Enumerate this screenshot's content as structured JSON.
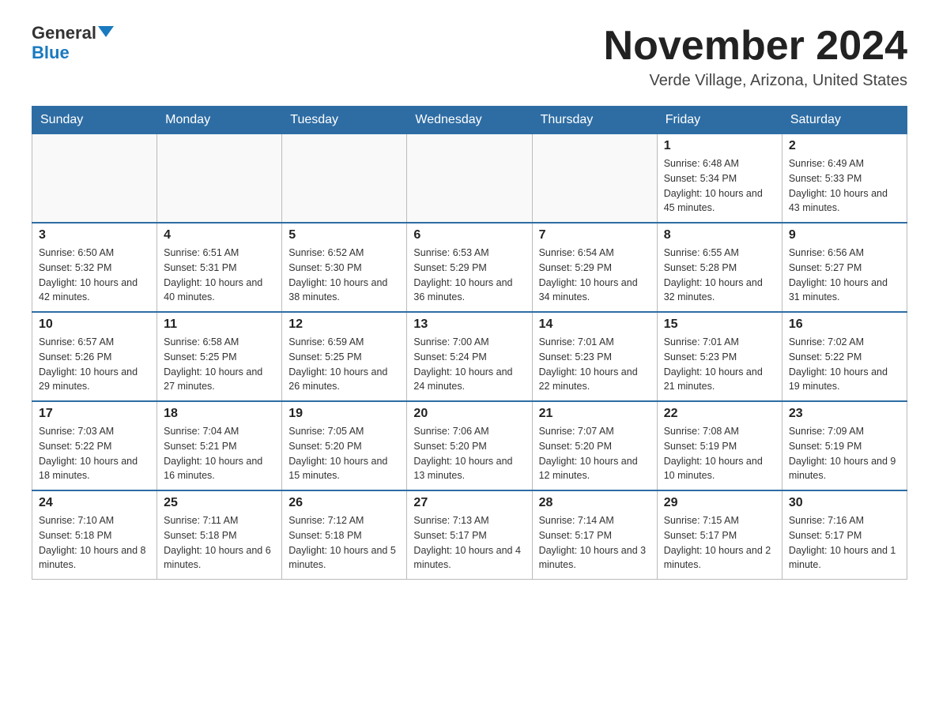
{
  "header": {
    "logo_general": "General",
    "logo_blue": "Blue",
    "month_title": "November 2024",
    "location": "Verde Village, Arizona, United States"
  },
  "weekdays": [
    "Sunday",
    "Monday",
    "Tuesday",
    "Wednesday",
    "Thursday",
    "Friday",
    "Saturday"
  ],
  "weeks": [
    [
      {
        "day": "",
        "info": ""
      },
      {
        "day": "",
        "info": ""
      },
      {
        "day": "",
        "info": ""
      },
      {
        "day": "",
        "info": ""
      },
      {
        "day": "",
        "info": ""
      },
      {
        "day": "1",
        "info": "Sunrise: 6:48 AM\nSunset: 5:34 PM\nDaylight: 10 hours and 45 minutes."
      },
      {
        "day": "2",
        "info": "Sunrise: 6:49 AM\nSunset: 5:33 PM\nDaylight: 10 hours and 43 minutes."
      }
    ],
    [
      {
        "day": "3",
        "info": "Sunrise: 6:50 AM\nSunset: 5:32 PM\nDaylight: 10 hours and 42 minutes."
      },
      {
        "day": "4",
        "info": "Sunrise: 6:51 AM\nSunset: 5:31 PM\nDaylight: 10 hours and 40 minutes."
      },
      {
        "day": "5",
        "info": "Sunrise: 6:52 AM\nSunset: 5:30 PM\nDaylight: 10 hours and 38 minutes."
      },
      {
        "day": "6",
        "info": "Sunrise: 6:53 AM\nSunset: 5:29 PM\nDaylight: 10 hours and 36 minutes."
      },
      {
        "day": "7",
        "info": "Sunrise: 6:54 AM\nSunset: 5:29 PM\nDaylight: 10 hours and 34 minutes."
      },
      {
        "day": "8",
        "info": "Sunrise: 6:55 AM\nSunset: 5:28 PM\nDaylight: 10 hours and 32 minutes."
      },
      {
        "day": "9",
        "info": "Sunrise: 6:56 AM\nSunset: 5:27 PM\nDaylight: 10 hours and 31 minutes."
      }
    ],
    [
      {
        "day": "10",
        "info": "Sunrise: 6:57 AM\nSunset: 5:26 PM\nDaylight: 10 hours and 29 minutes."
      },
      {
        "day": "11",
        "info": "Sunrise: 6:58 AM\nSunset: 5:25 PM\nDaylight: 10 hours and 27 minutes."
      },
      {
        "day": "12",
        "info": "Sunrise: 6:59 AM\nSunset: 5:25 PM\nDaylight: 10 hours and 26 minutes."
      },
      {
        "day": "13",
        "info": "Sunrise: 7:00 AM\nSunset: 5:24 PM\nDaylight: 10 hours and 24 minutes."
      },
      {
        "day": "14",
        "info": "Sunrise: 7:01 AM\nSunset: 5:23 PM\nDaylight: 10 hours and 22 minutes."
      },
      {
        "day": "15",
        "info": "Sunrise: 7:01 AM\nSunset: 5:23 PM\nDaylight: 10 hours and 21 minutes."
      },
      {
        "day": "16",
        "info": "Sunrise: 7:02 AM\nSunset: 5:22 PM\nDaylight: 10 hours and 19 minutes."
      }
    ],
    [
      {
        "day": "17",
        "info": "Sunrise: 7:03 AM\nSunset: 5:22 PM\nDaylight: 10 hours and 18 minutes."
      },
      {
        "day": "18",
        "info": "Sunrise: 7:04 AM\nSunset: 5:21 PM\nDaylight: 10 hours and 16 minutes."
      },
      {
        "day": "19",
        "info": "Sunrise: 7:05 AM\nSunset: 5:20 PM\nDaylight: 10 hours and 15 minutes."
      },
      {
        "day": "20",
        "info": "Sunrise: 7:06 AM\nSunset: 5:20 PM\nDaylight: 10 hours and 13 minutes."
      },
      {
        "day": "21",
        "info": "Sunrise: 7:07 AM\nSunset: 5:20 PM\nDaylight: 10 hours and 12 minutes."
      },
      {
        "day": "22",
        "info": "Sunrise: 7:08 AM\nSunset: 5:19 PM\nDaylight: 10 hours and 10 minutes."
      },
      {
        "day": "23",
        "info": "Sunrise: 7:09 AM\nSunset: 5:19 PM\nDaylight: 10 hours and 9 minutes."
      }
    ],
    [
      {
        "day": "24",
        "info": "Sunrise: 7:10 AM\nSunset: 5:18 PM\nDaylight: 10 hours and 8 minutes."
      },
      {
        "day": "25",
        "info": "Sunrise: 7:11 AM\nSunset: 5:18 PM\nDaylight: 10 hours and 6 minutes."
      },
      {
        "day": "26",
        "info": "Sunrise: 7:12 AM\nSunset: 5:18 PM\nDaylight: 10 hours and 5 minutes."
      },
      {
        "day": "27",
        "info": "Sunrise: 7:13 AM\nSunset: 5:17 PM\nDaylight: 10 hours and 4 minutes."
      },
      {
        "day": "28",
        "info": "Sunrise: 7:14 AM\nSunset: 5:17 PM\nDaylight: 10 hours and 3 minutes."
      },
      {
        "day": "29",
        "info": "Sunrise: 7:15 AM\nSunset: 5:17 PM\nDaylight: 10 hours and 2 minutes."
      },
      {
        "day": "30",
        "info": "Sunrise: 7:16 AM\nSunset: 5:17 PM\nDaylight: 10 hours and 1 minute."
      }
    ]
  ]
}
